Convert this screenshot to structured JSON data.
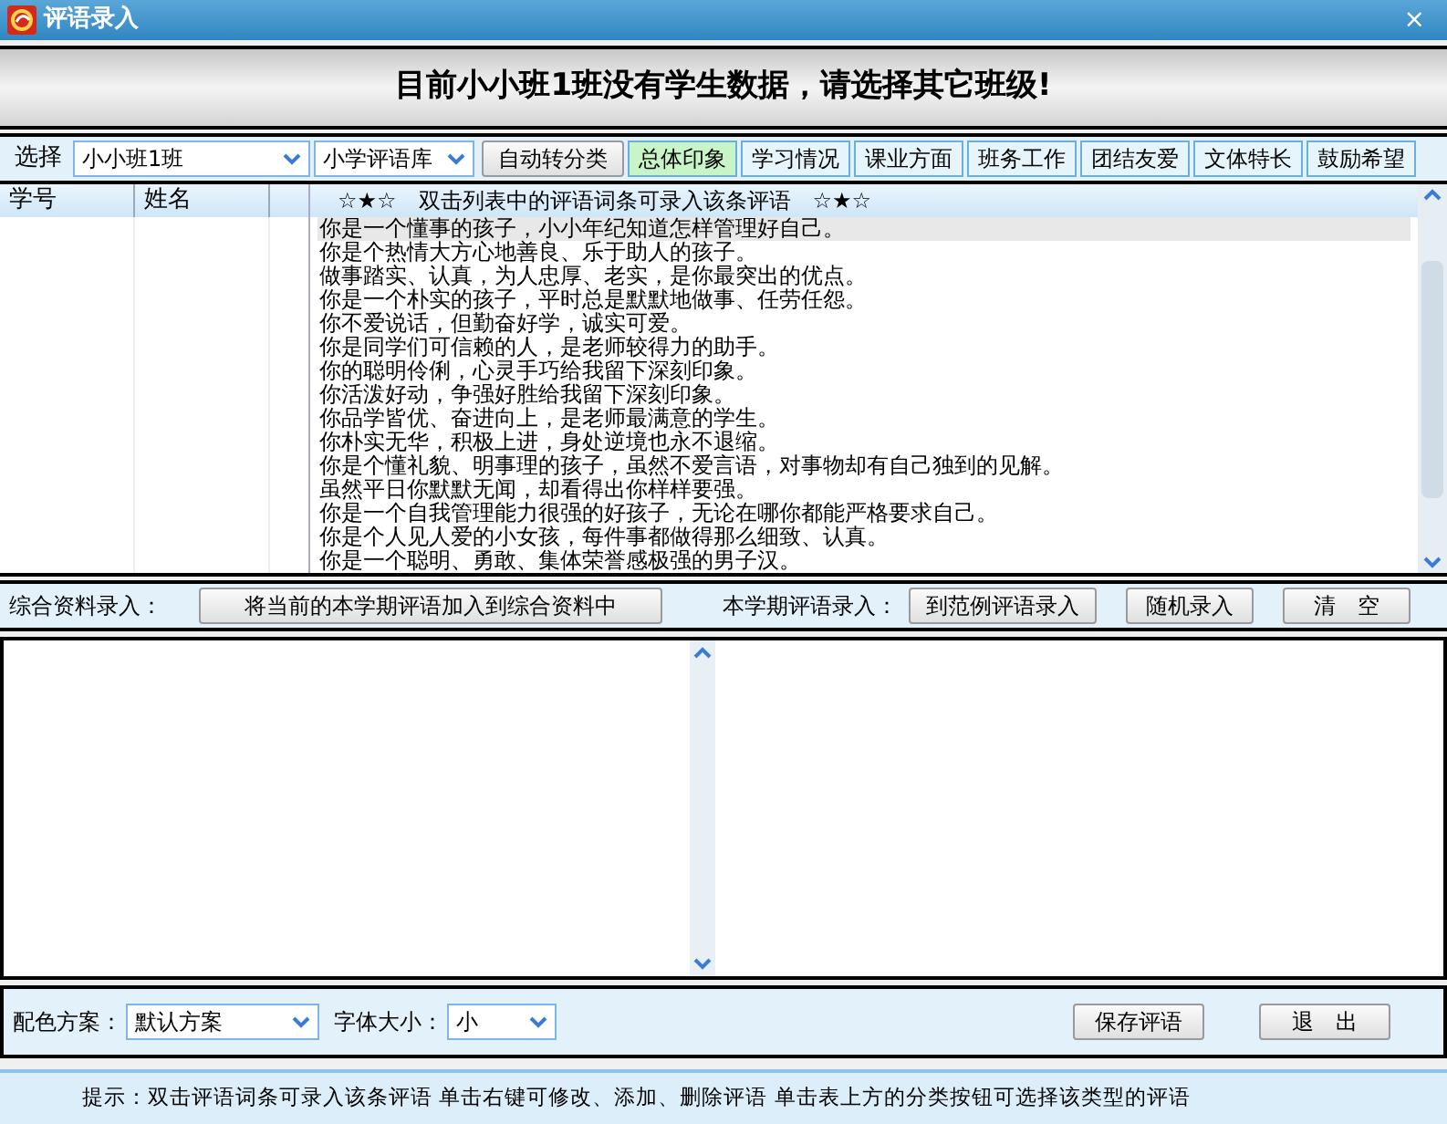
{
  "window": {
    "title": "评语录入",
    "close": "×"
  },
  "banner": "目前小小班1班没有学生数据，请选择其它班级!",
  "toolbar": {
    "select_label": "选择",
    "class_select": "小小班1班",
    "library_select": "小学评语库",
    "auto_button": "自动转分类",
    "tabs": [
      {
        "label": "总体印象",
        "selected": true
      },
      {
        "label": "学习情况",
        "selected": false
      },
      {
        "label": "课业方面",
        "selected": false
      },
      {
        "label": "班务工作",
        "selected": false
      },
      {
        "label": "团结友爱",
        "selected": false
      },
      {
        "label": "文体特长",
        "selected": false
      },
      {
        "label": "鼓励希望",
        "selected": false
      }
    ]
  },
  "student_table": {
    "columns": [
      "学号",
      "姓名"
    ]
  },
  "comment_list": {
    "header": "☆★☆　双击列表中的评语词条可录入该条评语　☆★☆",
    "items": [
      {
        "text": "你是一个懂事的孩子，小小年纪知道怎样管理好自己。",
        "selected": true
      },
      {
        "text": "你是个热情大方心地善良、乐于助人的孩子。",
        "selected": false
      },
      {
        "text": "做事踏实、认真，为人忠厚、老实，是你最突出的优点。",
        "selected": false
      },
      {
        "text": "你是一个朴实的孩子，平时总是默默地做事、任劳任怨。",
        "selected": false
      },
      {
        "text": "你不爱说话，但勤奋好学，诚实可爱。",
        "selected": false
      },
      {
        "text": "你是同学们可信赖的人，是老师较得力的助手。",
        "selected": false
      },
      {
        "text": "你的聪明伶俐，心灵手巧给我留下深刻印象。",
        "selected": false
      },
      {
        "text": "你活泼好动，争强好胜给我留下深刻印象。",
        "selected": false
      },
      {
        "text": "你品学皆优、奋进向上，是老师最满意的学生。",
        "selected": false
      },
      {
        "text": "你朴实无华，积极上进，身处逆境也永不退缩。",
        "selected": false
      },
      {
        "text": "你是个懂礼貌、明事理的孩子，虽然不爱言语，对事物却有自己独到的见解。",
        "selected": false
      },
      {
        "text": "虽然平日你默默无闻，却看得出你样样要强。",
        "selected": false
      },
      {
        "text": "你是一个自我管理能力很强的好孩子，无论在哪你都能严格要求自己。",
        "selected": false
      },
      {
        "text": "你是个人见人爱的小女孩，每件事都做得那么细致、认真。",
        "selected": false
      },
      {
        "text": "你是一个聪明、勇敢、集体荣誉感极强的男子汉。",
        "selected": false
      }
    ]
  },
  "action_bar": {
    "archive_label": "综合资料录入：",
    "archive_button": "将当前的本学期评语加入到综合资料中",
    "term_label": "本学期评语录入：",
    "example_button": "到范例评语录入",
    "random_button": "随机录入",
    "clear_button": "清　空"
  },
  "bottom_bar": {
    "scheme_label": "配色方案：",
    "scheme_select": "默认方案",
    "font_label": "字体大小：",
    "font_select": "小",
    "save_button": "保存评语",
    "exit_button": "退　出"
  },
  "status_bar": "提示：双击评语词条可录入该条评语 单击右键可修改、添加、删除评语 单击表上方的分类按钮可选择该类型的评语"
}
